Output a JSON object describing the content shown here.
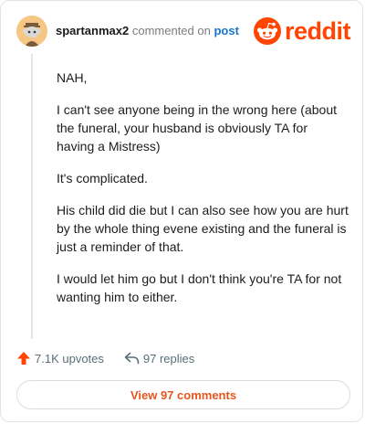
{
  "comment": {
    "username": "spartanmax2",
    "action_text": "commented on",
    "post_link_text": "post",
    "paragraphs": [
      "NAH,",
      "I can't see anyone being in the wrong here (about the funeral, your husband is obviously TA for having a Mistress)",
      "It's complicated.",
      "His child did die but I can also see how you are hurt by the whole thing evene existing and the funeral is just a reminder of that.",
      "I would let him go but I don't think you're TA for not wanting him to either."
    ]
  },
  "branding": {
    "logo_text": "reddit",
    "logo_icon": "reddit-snoo-icon",
    "brand_color": "#ff4500"
  },
  "actions": {
    "upvotes_label": "7.1K upvotes",
    "upvote_icon": "upvote-arrow-icon",
    "upvote_color": "#ff4500",
    "replies_label": "97 replies",
    "reply_icon": "reply-arrow-icon"
  },
  "footer": {
    "view_comments_label": "View 97 comments",
    "link_color": "#e6561e"
  }
}
